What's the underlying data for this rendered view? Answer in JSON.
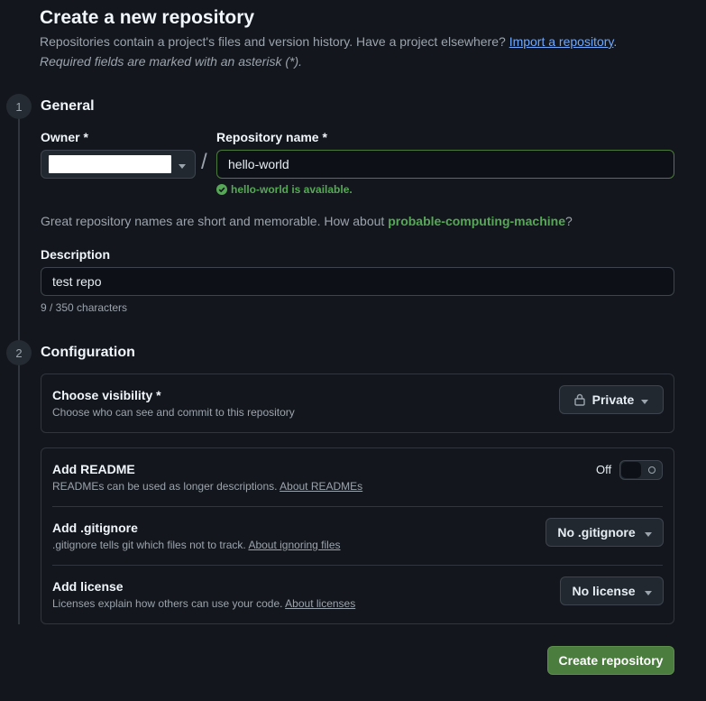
{
  "header": {
    "title": "Create a new repository",
    "subtitle_text": "Repositories contain a project's files and version history. Have a project elsewhere?",
    "import_link": "Import a repository",
    "subtitle_end": ".",
    "required_note": "Required fields are marked with an asterisk (*)."
  },
  "general": {
    "step": "1",
    "title": "General",
    "owner_label": "Owner *",
    "owner_value": "",
    "slash": "/",
    "repo_label": "Repository name *",
    "repo_value": "hello-world",
    "availability": "hello-world is available.",
    "suggestion_prefix": "Great repository names are short and memorable. How about",
    "suggestion_name": "probable-computing-machine",
    "suggestion_suffix": "?",
    "description_label": "Description",
    "description_value": "test repo",
    "char_count": "9 / 350 characters"
  },
  "configuration": {
    "step": "2",
    "title": "Configuration",
    "visibility_title": "Choose visibility *",
    "visibility_desc": "Choose who can see and commit to this repository",
    "visibility_value": "Private",
    "readme_title": "Add README",
    "readme_desc": "READMEs can be used as longer descriptions.",
    "readme_link": "About READMEs",
    "readme_toggle": "Off",
    "gitignore_title": "Add .gitignore",
    "gitignore_desc": ".gitignore tells git which files not to track.",
    "gitignore_link": "About ignoring files",
    "gitignore_value": "No .gitignore",
    "license_title": "Add license",
    "license_desc": "Licenses explain how others can use your code.",
    "license_link": "About licenses",
    "license_value": "No license"
  },
  "actions": {
    "create": "Create repository"
  },
  "colors": {
    "accent_green": "#4b7d3e",
    "success": "#56a857",
    "link": "#6ea8ff"
  },
  "icons": [
    "check-circle-icon",
    "lock-icon",
    "caret-down-icon"
  ]
}
